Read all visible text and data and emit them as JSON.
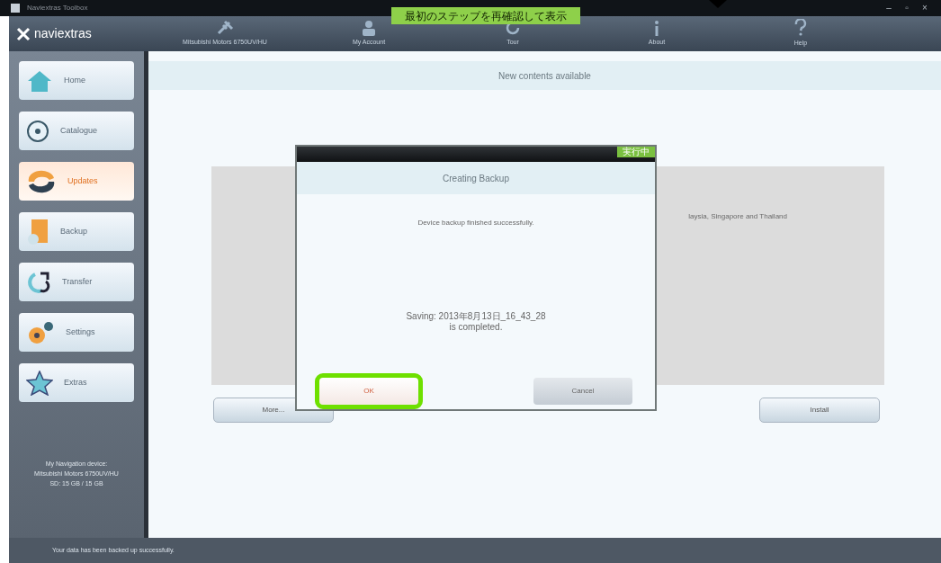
{
  "window": {
    "title": "Naviextras Toolbox",
    "controls": [
      "–",
      "▫",
      "×"
    ]
  },
  "banner": {
    "text": "最初のステップを再確認して表示"
  },
  "toolbar": {
    "brand": "naviextras",
    "items": [
      {
        "label": "Mitsubishi Motors 6750UV/HU",
        "kind": "device"
      },
      {
        "label": "My Account",
        "kind": "account"
      },
      {
        "label": "Tour",
        "kind": "tour"
      },
      {
        "label": "About",
        "kind": "about"
      },
      {
        "label": "Help",
        "kind": "help"
      }
    ]
  },
  "sidebar": {
    "items": [
      {
        "label": "Home",
        "kind": "home",
        "selected": false
      },
      {
        "label": "Catalogue",
        "kind": "catalogue",
        "selected": false
      },
      {
        "label": "Updates",
        "kind": "updates",
        "selected": true
      },
      {
        "label": "Backup",
        "kind": "backup",
        "selected": false
      },
      {
        "label": "Transfer",
        "kind": "transfer",
        "selected": false
      },
      {
        "label": "Settings",
        "kind": "settings",
        "selected": false
      },
      {
        "label": "Extras",
        "kind": "extras",
        "selected": false
      }
    ],
    "device_info": [
      "My Navigation device:",
      "Mitsubishi Motors 6750UV/HU",
      "SD: 15 GB / 15 GB"
    ]
  },
  "main": {
    "title": "New contents available",
    "content_text": "laysia, Singapore and Thailand",
    "buttons": [
      "More...",
      "Install"
    ]
  },
  "dialog": {
    "badge": "実行中",
    "title": "Creating Backup",
    "message": "Device backup finished successfully.",
    "detail": [
      "Saving: 2013年8月13日_16_43_28",
      "is completed."
    ],
    "buttons": [
      {
        "label": "OK",
        "highlighted": true
      },
      {
        "label": "Cancel",
        "highlighted": false
      }
    ]
  },
  "status_bar": {
    "text": "Your data has been backed up successfully."
  }
}
